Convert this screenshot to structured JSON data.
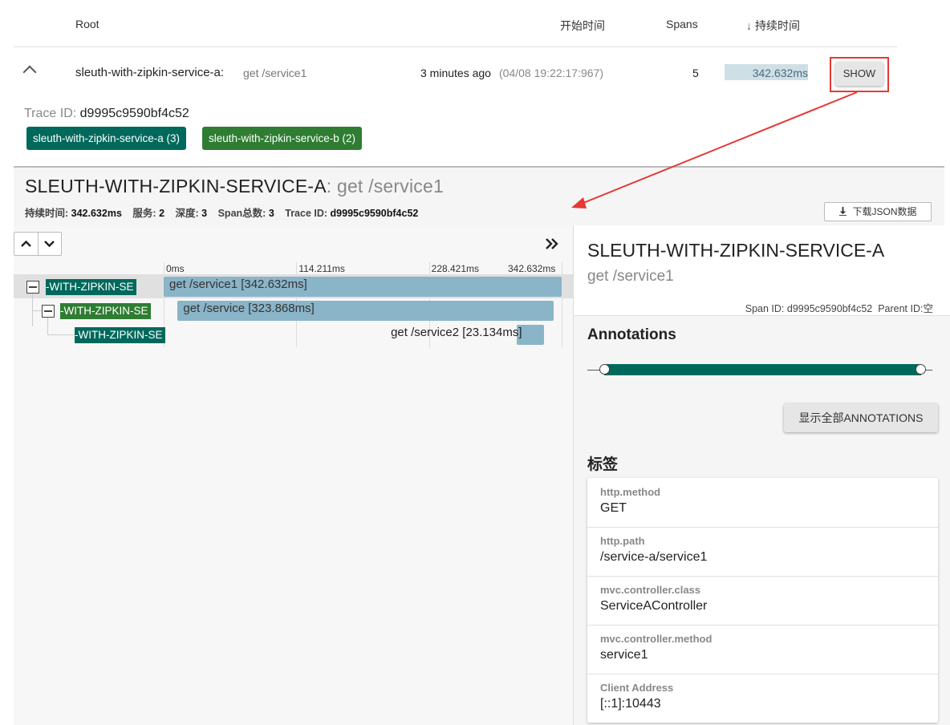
{
  "trace_list": {
    "headers": {
      "root": "Root",
      "start_time": "开始时间",
      "spans": "Spans",
      "duration_sort_icon": "↓",
      "duration": "持续时间"
    },
    "row": {
      "service": "sleuth-with-zipkin-service-a:",
      "path": "get /service1",
      "relative_time": "3 minutes ago",
      "timestamp": "(04/08 19:22:17:967)",
      "span_count": "5",
      "duration": "342.632ms",
      "duration_fraction": 1.0,
      "show_label": "SHOW"
    },
    "trace_id_label": "Trace ID:",
    "trace_id": "d9995c9590bf4c52",
    "service_badges": [
      {
        "label": "sleuth-with-zipkin-service-a (3)",
        "color": "#00695c"
      },
      {
        "label": "sleuth-with-zipkin-service-b (2)",
        "color": "#2e7d32"
      }
    ]
  },
  "trace_header": {
    "title_service": "SLEUTH-WITH-ZIPKIN-SERVICE-A",
    "title_sep": ":",
    "title_path": "get /service1",
    "meta": {
      "duration_label": "持续时间:",
      "duration": "342.632ms",
      "services_label": "服务:",
      "services": "2",
      "depth_label": "深度:",
      "depth": "3",
      "total_spans_label": "Span总数:",
      "total_spans": "3",
      "trace_id_label": "Trace ID:",
      "trace_id": "d9995c9590bf4c52"
    },
    "download_label": "下载JSON数据"
  },
  "timeline": {
    "ticks": [
      "0ms",
      "114.211ms",
      "228.421ms",
      "342.632ms"
    ],
    "spans": [
      {
        "service": "-WITH-ZIPKIN-SE",
        "service_color": "#00695c",
        "label": "get /service1 [342.632ms]",
        "start_ms": 0,
        "duration_ms": 342.632
      },
      {
        "service": "-WITH-ZIPKIN-SE",
        "service_color": "#2e7d32",
        "label": "get /service [323.868ms]",
        "start_ms": 12.0,
        "duration_ms": 323.868
      },
      {
        "service": "-WITH-ZIPKIN-SE",
        "service_color": "#00695c",
        "label": "get /service2 [23.134ms]",
        "start_ms": 304.0,
        "duration_ms": 23.134
      }
    ],
    "colors": {
      "bar": "#8ab4c8"
    }
  },
  "detail": {
    "service": "SLEUTH-WITH-ZIPKIN-SERVICE-A",
    "path": "get /service1",
    "span_id_label": "Span ID:",
    "span_id": "d9995c9590bf4c52",
    "parent_id_label": "Parent ID:",
    "parent_id": "空",
    "annotations_title": "Annotations",
    "show_all_label": "显示全部ANNOTATIONS",
    "tags_title": "标签",
    "tags": [
      {
        "key": "http.method",
        "value": "GET"
      },
      {
        "key": "http.path",
        "value": "/service-a/service1"
      },
      {
        "key": "mvc.controller.class",
        "value": "ServiceAController"
      },
      {
        "key": "mvc.controller.method",
        "value": "service1"
      },
      {
        "key": "Client Address",
        "value": "[::1]:10443"
      }
    ]
  },
  "annotation_color": "#e53935"
}
